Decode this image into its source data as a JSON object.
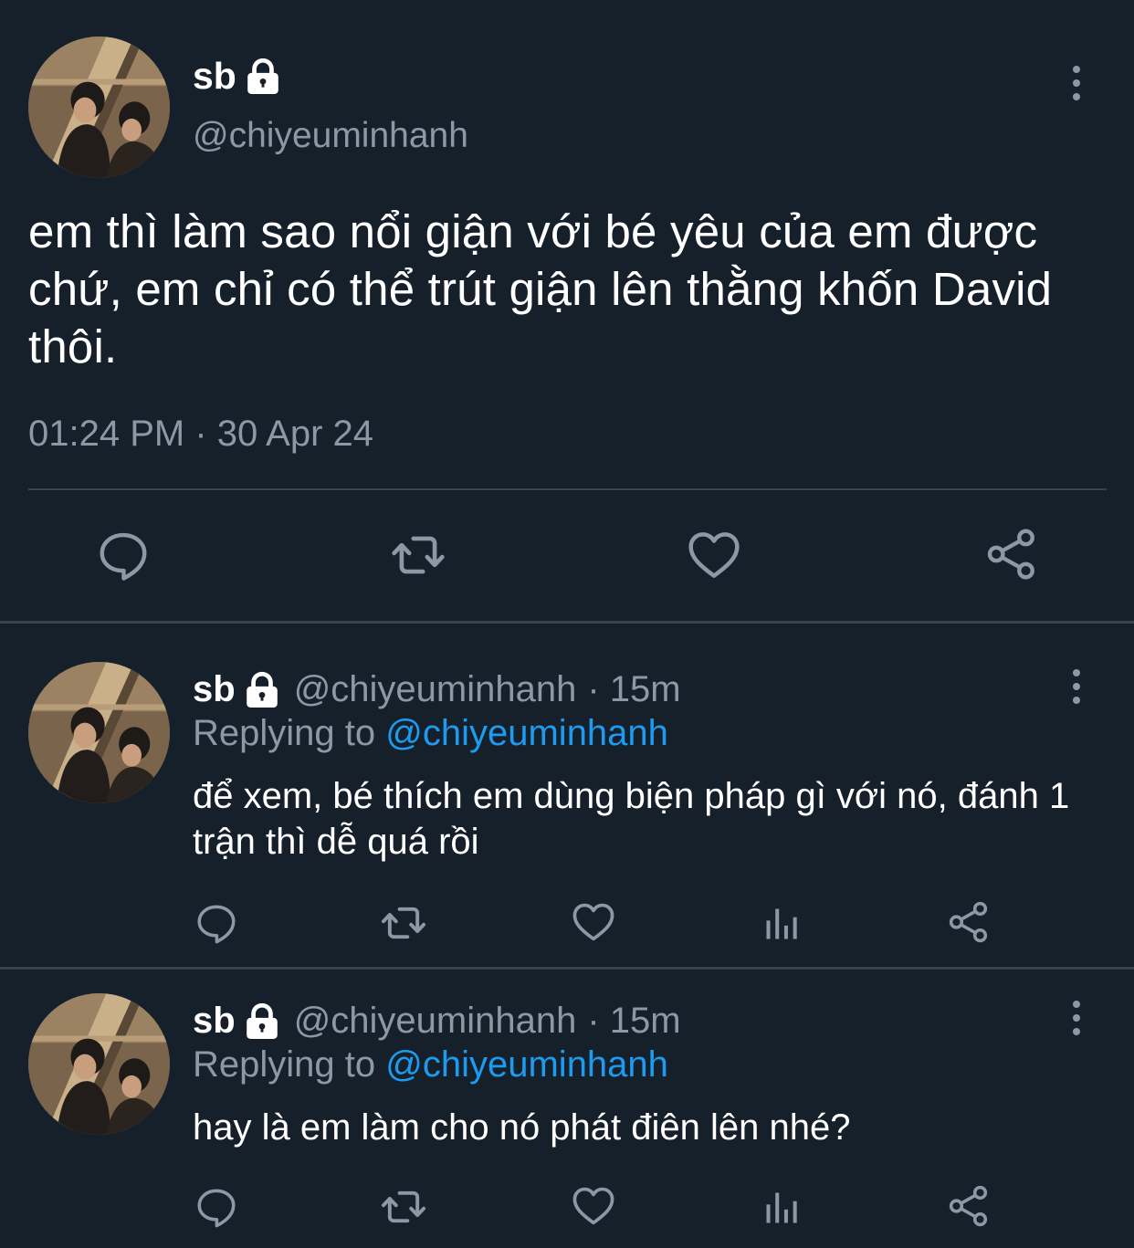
{
  "main_tweet": {
    "display_name": "sb",
    "handle": "@chiyeuminhanh",
    "text": "em thì làm sao nổi giận với bé yêu của em được chứ, em chỉ có thể trút giận lên thằng khốn David thôi.",
    "timestamp": "01:24 PM · 30 Apr 24",
    "actions": [
      "reply-icon",
      "retweet-icon",
      "like-icon",
      "share-icon"
    ]
  },
  "replies": [
    {
      "display_name": "sb",
      "handle": "@chiyeuminhanh",
      "time": "· 15m",
      "replying_prefix": "Replying to",
      "replying_to": "@chiyeuminhanh",
      "text": "để xem, bé thích em dùng biện pháp gì với nó, đánh 1 trận thì dễ quá rồi",
      "actions": [
        "reply-icon",
        "retweet-icon",
        "like-icon",
        "analytics-icon",
        "share-icon"
      ]
    },
    {
      "display_name": "sb",
      "handle": "@chiyeuminhanh",
      "time": "· 15m",
      "replying_prefix": "Replying to",
      "replying_to": "@chiyeuminhanh",
      "text": "hay là em làm cho nó phát điên lên nhé?",
      "actions": [
        "reply-icon",
        "retweet-icon",
        "like-icon",
        "analytics-icon",
        "share-icon"
      ]
    }
  ],
  "colors": {
    "background": "#15202b",
    "secondary_text": "#8b98a5",
    "mention": "#1d9bf0",
    "divider": "#38444d"
  }
}
